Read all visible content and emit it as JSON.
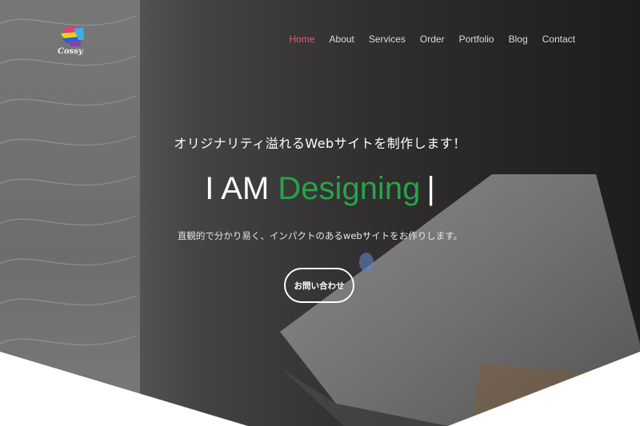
{
  "brand": {
    "logo_text": "Cossy",
    "logo_colors": [
      "#e63b7a",
      "#f6d21b",
      "#2f5fd0",
      "#34b3e4",
      "#8b3fb5"
    ]
  },
  "nav": {
    "items": [
      {
        "label": "Home",
        "active": true
      },
      {
        "label": "About",
        "active": false
      },
      {
        "label": "Services",
        "active": false
      },
      {
        "label": "Order",
        "active": false
      },
      {
        "label": "Portfolio",
        "active": false
      },
      {
        "label": "Blog",
        "active": false
      },
      {
        "label": "Contact",
        "active": false
      }
    ],
    "active_color": "#e05b79"
  },
  "hero": {
    "tagline": "オリジナリティ溢れるWebサイトを制作します！",
    "headline_prefix": "I AM ",
    "headline_accent": "Designing",
    "headline_cursor": "|",
    "accent_color": "#27a34a",
    "subtext": "直観的で分かり易く、インパクトのあるwebサイトをお作りします。",
    "cta_label": "お問い合わせ"
  }
}
